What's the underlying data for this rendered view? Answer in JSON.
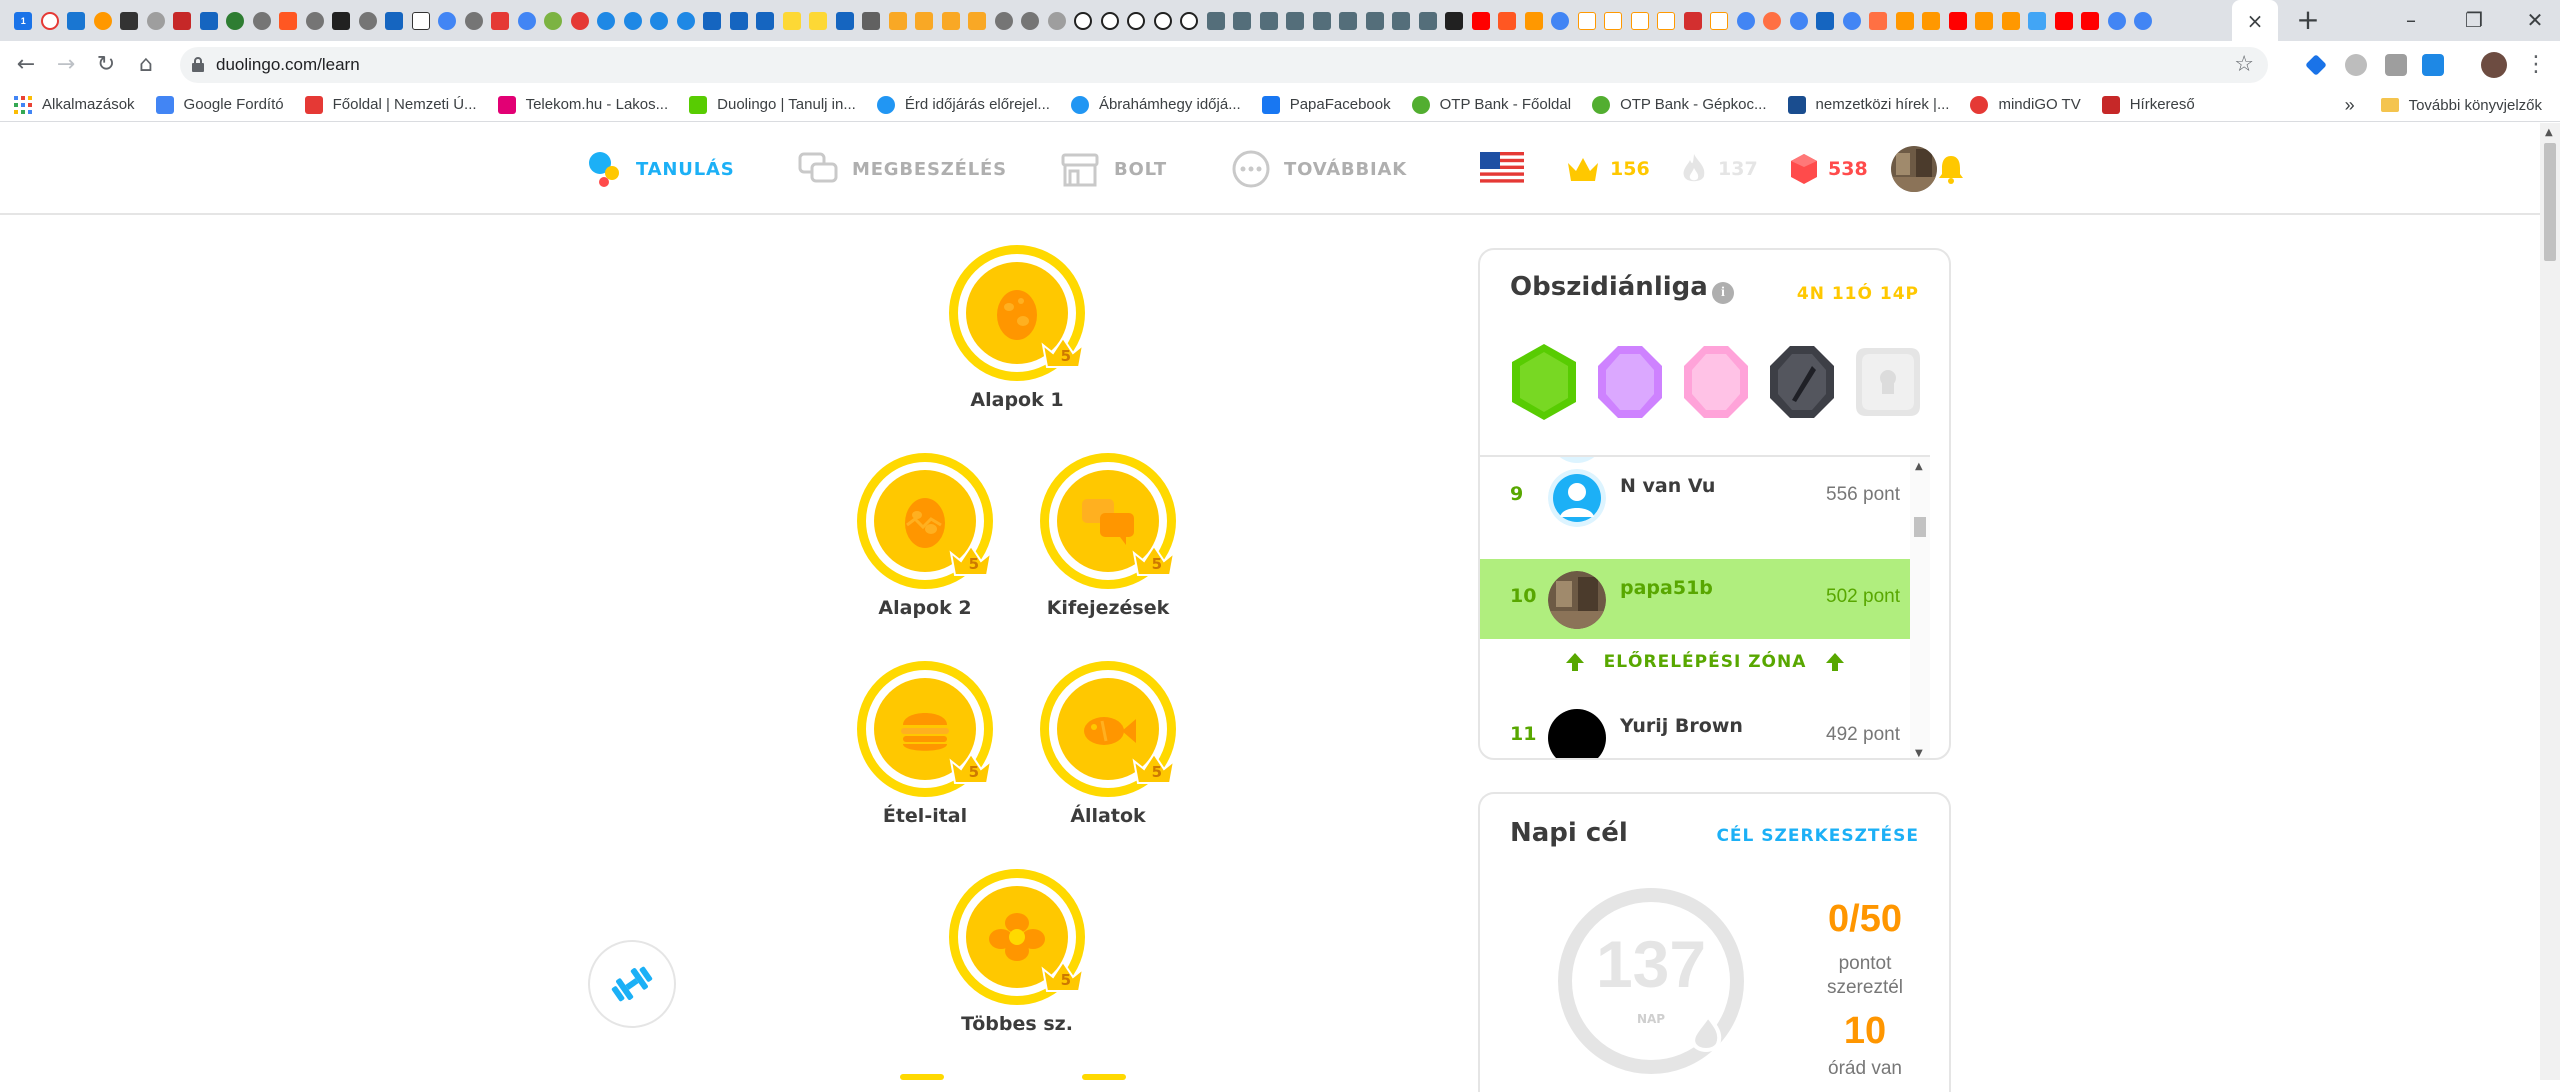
{
  "browser": {
    "url": "duolingo.com/learn",
    "tab_close": "×",
    "new_tab": "+",
    "bookmarks": [
      {
        "label": "Alkalmazások",
        "icon": "apps-grid-icon",
        "color": "#4285f4"
      },
      {
        "label": "Google Fordító",
        "icon": "google-translate-icon",
        "color": "#4285f4"
      },
      {
        "label": "Főoldal | Nemzeti Ú...",
        "icon": "nemzeti-icon",
        "color": "#e53935"
      },
      {
        "label": "Telekom.hu - Lakos...",
        "icon": "telekom-icon",
        "color": "#e20074"
      },
      {
        "label": "Duolingo | Tanulj in...",
        "icon": "duolingo-icon",
        "color": "#58cc02"
      },
      {
        "label": "Érd időjárás előrejel...",
        "icon": "weather-icon",
        "color": "#2196f3"
      },
      {
        "label": "Ábrahámhegy időjá...",
        "icon": "weather-icon",
        "color": "#2196f3"
      },
      {
        "label": "PapaFacebook",
        "icon": "facebook-icon",
        "color": "#1877f2"
      },
      {
        "label": "OTP Bank - Főoldal",
        "icon": "otp-icon",
        "color": "#52ae30"
      },
      {
        "label": "OTP Bank - Gépkoc...",
        "icon": "otp-icon",
        "color": "#52ae30"
      },
      {
        "label": "nemzetközi hírek |...",
        "icon": "en-icon",
        "color": "#1a4d8f"
      },
      {
        "label": "mindiGO TV",
        "icon": "mindigo-icon",
        "color": "#e53935"
      },
      {
        "label": "Hírkereső",
        "icon": "hirkereso-icon",
        "color": "#c62828"
      }
    ],
    "bookmarks_more": "»",
    "other_bookmarks": "További könyvjelzők"
  },
  "header": {
    "nav": [
      {
        "label": "TANULÁS",
        "color": "#1cb0f6"
      },
      {
        "label": "MEGBESZÉLÉS",
        "color": "#afafaf"
      },
      {
        "label": "BOLT",
        "color": "#afafaf"
      },
      {
        "label": "TOVÁBBIAK",
        "color": "#afafaf"
      }
    ],
    "crowns": "156",
    "streak": "137",
    "gems": "538"
  },
  "skills": [
    {
      "name": "Alapok 1",
      "level": "5",
      "icon": "egg-icon"
    },
    {
      "name": "Alapok 2",
      "level": "5",
      "icon": "egg-icon"
    },
    {
      "name": "Kifejezések",
      "level": "5",
      "icon": "speech-bubbles-icon"
    },
    {
      "name": "Étel-ital",
      "level": "5",
      "icon": "burger-icon"
    },
    {
      "name": "Állatok",
      "level": "5",
      "icon": "fish-icon"
    },
    {
      "name": "Többes sz.",
      "level": "5",
      "icon": "flower-icon"
    }
  ],
  "league": {
    "title": "Obszidiánliga",
    "info": "i",
    "time_left": "4N 11Ó 14P",
    "rows": [
      {
        "rank": "9",
        "name": "N van Vu",
        "points": "556 pont"
      },
      {
        "rank": "10",
        "name": "papa51b",
        "points": "502 pont"
      },
      {
        "rank": "11",
        "name": "Yurij Brown",
        "points": "492 pont"
      }
    ],
    "promotion_zone": "ELŐRELÉPÉSI ZÓNA"
  },
  "daily_goal": {
    "title": "Napi cél",
    "edit": "CÉL SZERKESZTÉSE",
    "streak_days": "137",
    "streak_unit": "NAP",
    "points": "0/50",
    "points_text_1": "pontot",
    "points_text_2": "szereztél",
    "hours": "10",
    "hours_text": "órád van"
  }
}
